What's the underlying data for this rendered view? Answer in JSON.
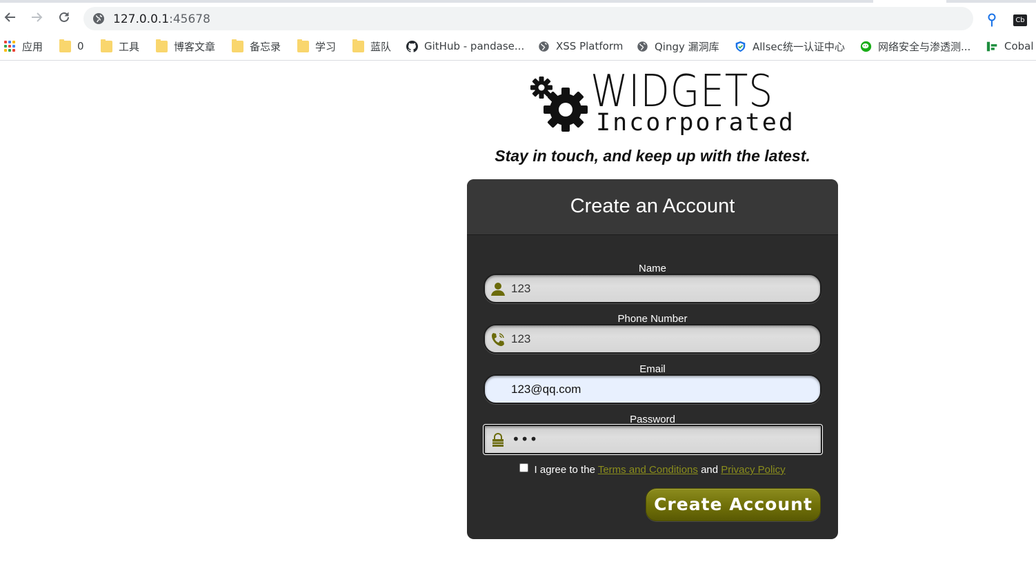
{
  "browser": {
    "url_host": "127.0.0.1",
    "url_port": ":45678",
    "extension_label": "Cb",
    "bookmarks": [
      {
        "label": "应用",
        "icon": "apps-grid-icon"
      },
      {
        "label": "0",
        "icon": "folder-icon"
      },
      {
        "label": "工具",
        "icon": "folder-icon"
      },
      {
        "label": "博客文章",
        "icon": "folder-icon"
      },
      {
        "label": "备忘录",
        "icon": "folder-icon"
      },
      {
        "label": "学习",
        "icon": "folder-icon"
      },
      {
        "label": "蓝队",
        "icon": "folder-icon"
      },
      {
        "label": "GitHub - pandase...",
        "icon": "github-icon"
      },
      {
        "label": "XSS Platform",
        "icon": "globe-icon"
      },
      {
        "label": "Qingy 漏洞库",
        "icon": "globe-icon"
      },
      {
        "label": "Allsec统一认证中心",
        "icon": "shield-icon"
      },
      {
        "label": "网络安全与渗透测...",
        "icon": "wechat-icon"
      },
      {
        "label": "Cobal",
        "icon": "bar-logo-icon"
      }
    ]
  },
  "page": {
    "logo_word": "WIDGETS",
    "logo_sub": "Incorporated",
    "tagline": "Stay in touch, and keep up with the latest.",
    "form": {
      "title": "Create an Account",
      "name_label": "Name",
      "name_value": "123",
      "phone_label": "Phone Number",
      "phone_value": "123",
      "email_label": "Email",
      "email_value": "123@qq.com",
      "password_label": "Password",
      "password_mask": "•••",
      "agree_prefix": "I agree to the",
      "terms_link": "Terms and Conditions",
      "agree_and": "and",
      "privacy_link": "Privacy Policy",
      "submit_label": "Create Account"
    }
  },
  "colors": {
    "card_bg": "#2b2b2b",
    "accent_olive": "#6f6f08",
    "link": "#8a8d1c",
    "icon_olive": "#6b6b0b"
  }
}
